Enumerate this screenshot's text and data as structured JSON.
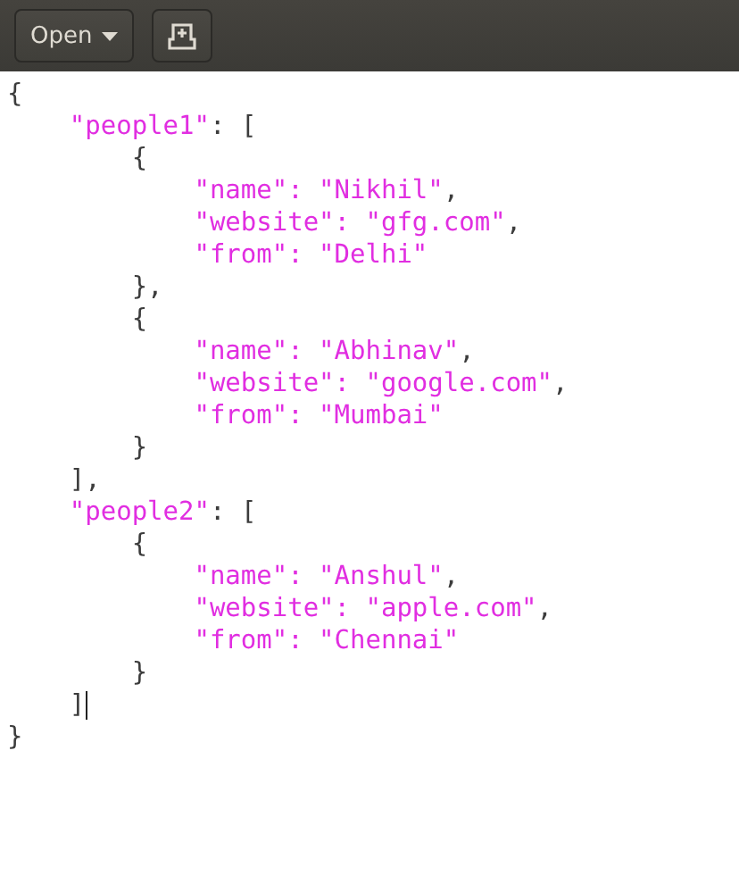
{
  "toolbar": {
    "open_button": {
      "label": "Open"
    }
  },
  "editor": {
    "lines": [
      {
        "tokens": [
          {
            "kind": "punct",
            "text": "{"
          }
        ],
        "children": [
          {
            "tokens": [
              {
                "kind": "string",
                "text": "\"people1\""
              },
              {
                "kind": "punct",
                "text": ": ["
              }
            ],
            "children": [
              {
                "tokens": [
                  {
                    "kind": "punct",
                    "text": "{"
                  }
                ],
                "children": [
                  {
                    "tokens": [
                      {
                        "kind": "string",
                        "text": "\"name\": \"Nikhil\""
                      },
                      {
                        "kind": "punct",
                        "text": ","
                      }
                    ]
                  },
                  {
                    "tokens": [
                      {
                        "kind": "string",
                        "text": "\"website\": \"gfg.com\""
                      },
                      {
                        "kind": "punct",
                        "text": ","
                      }
                    ]
                  },
                  {
                    "tokens": [
                      {
                        "kind": "string",
                        "text": "\"from\": \"Delhi\""
                      }
                    ]
                  }
                ]
              },
              {
                "tokens": [
                  {
                    "kind": "punct",
                    "text": "},"
                  }
                ]
              },
              {
                "tokens": [
                  {
                    "kind": "punct",
                    "text": "{"
                  }
                ],
                "children": [
                  {
                    "tokens": [
                      {
                        "kind": "string",
                        "text": "\"name\": \"Abhinav\""
                      },
                      {
                        "kind": "punct",
                        "text": ","
                      }
                    ]
                  },
                  {
                    "tokens": [
                      {
                        "kind": "string",
                        "text": "\"website\": \"google.com\""
                      },
                      {
                        "kind": "punct",
                        "text": ","
                      }
                    ]
                  },
                  {
                    "tokens": [
                      {
                        "kind": "string",
                        "text": "\"from\": \"Mumbai\""
                      }
                    ]
                  }
                ]
              },
              {
                "tokens": [
                  {
                    "kind": "punct",
                    "text": "}"
                  }
                ]
              }
            ]
          },
          {
            "tokens": [
              {
                "kind": "punct",
                "text": "],"
              }
            ]
          },
          {
            "tokens": [
              {
                "kind": "string",
                "text": "\"people2\""
              },
              {
                "kind": "punct",
                "text": ": ["
              }
            ],
            "children": [
              {
                "tokens": [
                  {
                    "kind": "punct",
                    "text": "{"
                  }
                ],
                "children": [
                  {
                    "tokens": [
                      {
                        "kind": "string",
                        "text": "\"name\": \"Anshul\""
                      },
                      {
                        "kind": "punct",
                        "text": ","
                      }
                    ]
                  },
                  {
                    "tokens": [
                      {
                        "kind": "string",
                        "text": "\"website\": \"apple.com\""
                      },
                      {
                        "kind": "punct",
                        "text": ","
                      }
                    ]
                  },
                  {
                    "tokens": [
                      {
                        "kind": "string",
                        "text": "\"from\": \"Chennai\""
                      }
                    ]
                  }
                ]
              },
              {
                "tokens": [
                  {
                    "kind": "punct",
                    "text": "}"
                  }
                ]
              }
            ]
          },
          {
            "tokens": [
              {
                "kind": "punct",
                "text": "]"
              }
            ],
            "cursor": true
          }
        ]
      },
      {
        "tokens": [
          {
            "kind": "punct",
            "text": "}"
          }
        ]
      }
    ]
  }
}
